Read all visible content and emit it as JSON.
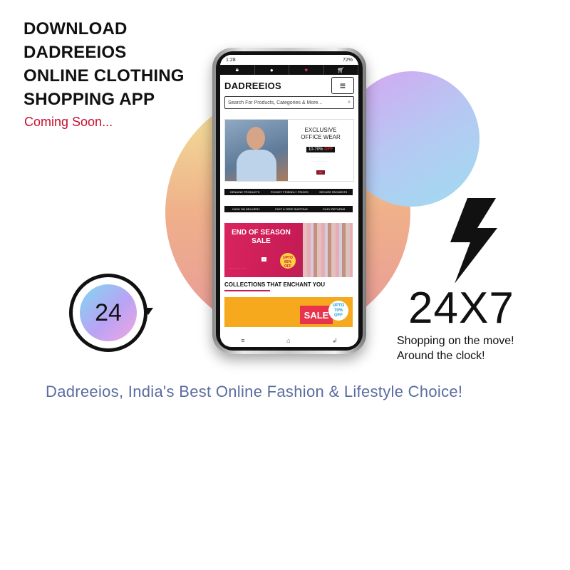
{
  "headline": {
    "line1": "DOWNLOAD",
    "line2": "DADREEIOS",
    "line3": "ONLINE CLOTHING",
    "line4": "SHOPPING APP",
    "coming_soon": "Coming Soon..."
  },
  "phone": {
    "status_time": "1:28",
    "status_battery": "72%",
    "brand": "DADREEIOS",
    "search_placeholder": "Search For Products, Categories & More...",
    "banner1": {
      "title_line1": "EXCLUSIVE",
      "title_line2": "OFFICE WEAR",
      "offer_prefix": "10-70%",
      "offer_suffix": "OFF"
    },
    "strip1": [
      "GENUINE PRODUCTS",
      "POCKET FRIENDLY PRICES",
      "SECURE PAYMENTS"
    ],
    "strip2": [
      "CASH ON DELIVERY",
      "FAST & FREE SHIPPING",
      "EASY RETURNS"
    ],
    "banner2": {
      "title_line1": "END OF SEASON",
      "title_line2": "SALE",
      "upto": "UPTO",
      "percent": "60%",
      "off": "OFF"
    },
    "collections_heading": "COLLECTIONS THAT ENCHANT YOU",
    "banner3": {
      "sale": "SALE",
      "upto": "UPTO",
      "percent": "70%",
      "off": "OFF"
    }
  },
  "badge": {
    "number": "24"
  },
  "promo": {
    "big": "24X7",
    "line1": "Shopping on the move!",
    "line2": "Around the clock!"
  },
  "tagline": "Dadreeios, India's Best Online Fashion & Lifestyle Choice!",
  "colors": {
    "accent_red": "#c8102e",
    "tagline": "#5a6da0",
    "sale_pink": "#c71b55"
  },
  "icons": [
    "lock-icon",
    "user-icon",
    "heart-icon",
    "cart-icon",
    "menu-icon",
    "search-icon",
    "bolt-icon",
    "clock-arrow-icon"
  ]
}
